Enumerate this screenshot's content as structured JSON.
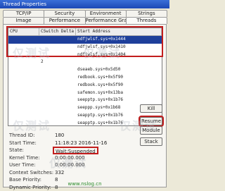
{
  "window": {
    "title": "Thread Properties"
  },
  "tabs": {
    "row1": [
      "TCP/IP",
      "Security",
      "Environment",
      "Strings"
    ],
    "row2": [
      "Image",
      "Performance",
      "Performance Graph",
      "Threads"
    ]
  },
  "grid": {
    "columns": [
      "CPU",
      "CSwitch Delta",
      "Start Address"
    ],
    "rows": [
      {
        "cpu": "",
        "delta": "",
        "addr": "ndfjwlsf.sys+0x1444",
        "selected": true
      },
      {
        "cpu": "",
        "delta": "",
        "addr": "ndfjwlsf.sys+0x1410",
        "selected": false
      },
      {
        "cpu": "",
        "delta": "",
        "addr": "ndfjwlsf.sys+0x1404",
        "selected": false
      },
      {
        "cpu": "",
        "delta": "2",
        "addr": "",
        "selected": false
      },
      {
        "cpu": "",
        "delta": "",
        "addr": "dseaeb.sys+0x5d50",
        "selected": false
      },
      {
        "cpu": "",
        "delta": "",
        "addr": "redbook.sys+0x5f90",
        "selected": false
      },
      {
        "cpu": "",
        "delta": "",
        "addr": "redbook.sys+0x5f90",
        "selected": false
      },
      {
        "cpu": "",
        "delta": "",
        "addr": "safemon.sys+0x13ba",
        "selected": false
      },
      {
        "cpu": "",
        "delta": "",
        "addr": "seepptp.sys+0x1b76",
        "selected": false
      },
      {
        "cpu": "",
        "delta": "",
        "addr": "seeppp.sys+0x1b68",
        "selected": false
      },
      {
        "cpu": "",
        "delta": "",
        "addr": "seapptp.sys+0x1b76",
        "selected": false
      },
      {
        "cpu": "",
        "delta": "",
        "addr": "seapptp.sys+0x1b76",
        "selected": false
      }
    ]
  },
  "properties": [
    {
      "label": "Thread ID:",
      "value": "180"
    },
    {
      "label": "Start Time:",
      "value": "11:18:23   2016-11-16"
    },
    {
      "label": "State:",
      "value": "Wait:Suspended"
    },
    {
      "label": "Kernel Time:",
      "value": "0:00:00.000"
    },
    {
      "label": "User Time:",
      "value": "0:00:00.000"
    },
    {
      "label": "Context Switches:",
      "value": "332"
    },
    {
      "label": "Base Priority:",
      "value": "8"
    },
    {
      "label": "Dynamic Priority:",
      "value": "8"
    }
  ],
  "buttons": {
    "kill": "Kill",
    "resume": "Resume",
    "module": "Module",
    "stack": "Stack"
  },
  "watermark": {
    "text": "仅测试"
  },
  "footer": {
    "text": "www.nslog.cn"
  },
  "colors": {
    "selection": "#1e3f9b",
    "highlight_box": "#c21d1d",
    "footer": "#2a8a2a"
  }
}
